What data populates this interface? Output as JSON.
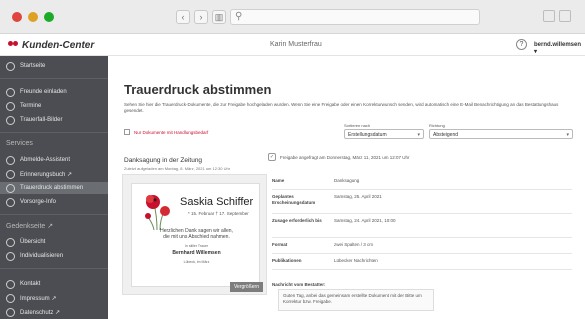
{
  "window": {
    "nav_back": "‹",
    "nav_forward": "›",
    "sidebar_toggle": "▥",
    "search_glyph": "⚲"
  },
  "header": {
    "app_name": "Kunden-Center",
    "user_center": "Karin Musterfrau",
    "help_glyph": "?",
    "account": "bernd.willemsen ▾"
  },
  "sidebar": {
    "items_top": [
      {
        "label": "Startseite"
      }
    ],
    "items_group1": [
      {
        "label": "Freunde einladen"
      },
      {
        "label": "Termine"
      },
      {
        "label": "Trauerfall-Bilder"
      }
    ],
    "section_services": "Services",
    "items_services": [
      {
        "label": "Abmelde-Assistent"
      },
      {
        "label": "Erinnerungsbuch ↗"
      },
      {
        "label": "Trauerdruck abstimmen"
      },
      {
        "label": "Vorsorge-Info"
      }
    ],
    "section_gedenk": "Gedenkseite ↗",
    "items_gedenk": [
      {
        "label": "Übersicht"
      },
      {
        "label": "Individualisieren"
      }
    ],
    "items_bottom": [
      {
        "label": "Kontakt"
      },
      {
        "label": "Impressum ↗"
      },
      {
        "label": "Datenschutz ↗"
      }
    ]
  },
  "main": {
    "title": "Trauerdruck abstimmen",
    "intro": "Sehen Sie hier die Trauerdruck-Dokumente, die zur Freigabe hochgeladen wurden. Wenn Sie eine Freigabe oder einen Korrekturwunsch senden, wird automatisch eine E-Mail Benachrichtigung an das Bestattungshaus gesendet.",
    "filter_label": "Nur Dokumente mit Handlungsbedarf",
    "sort_label": "Sortieren nach",
    "sort_value": "Erstellungsdatum",
    "dir_label": "Richtung",
    "dir_value": "Absteigend",
    "caret": "▾"
  },
  "document": {
    "heading": "Danksagung in der Zeitung",
    "uploaded": "Zuletzt aufgeladen am Montag, 8. März, 2021 um 12:30 Uhr",
    "release_glyph": "✓",
    "release_note": "Freigabe angefragt am Donnerstag, März 11, 2021 um 12:07 Uhr",
    "preview": {
      "name": "Saskia Schiffer",
      "dates": "* 15. Februar  † 17. September",
      "thanks_1": "Herzlichen Dank sagen wir allen,",
      "thanks_2": "die mit uns Abschied nahmen.",
      "mourning": "In stiller Trauer",
      "signer": "Bernhard Willemsen",
      "place": "Lübeck, im März",
      "enlarge": "Vergrößern"
    },
    "details": [
      {
        "label": "Name",
        "value": "Danksagung"
      },
      {
        "label": "Geplantes Erscheinungsdatum",
        "value": "Samstag, 25. April 2021"
      },
      {
        "label": "Zusage erforderlich bis",
        "value": "Samstag, 24. April 2021, 10:00"
      },
      {
        "label": "Format",
        "value": "zwei Spalten / 3 cm"
      },
      {
        "label": "Publikationen",
        "value": "Lübecker Nachrichten"
      }
    ],
    "message_heading": "Nachricht vom Bestatter:",
    "message": "Guten Tag, anbei das gemeinsam erstellte Dokument mit der Bitte um Korrektur bzw. Freigabe."
  }
}
